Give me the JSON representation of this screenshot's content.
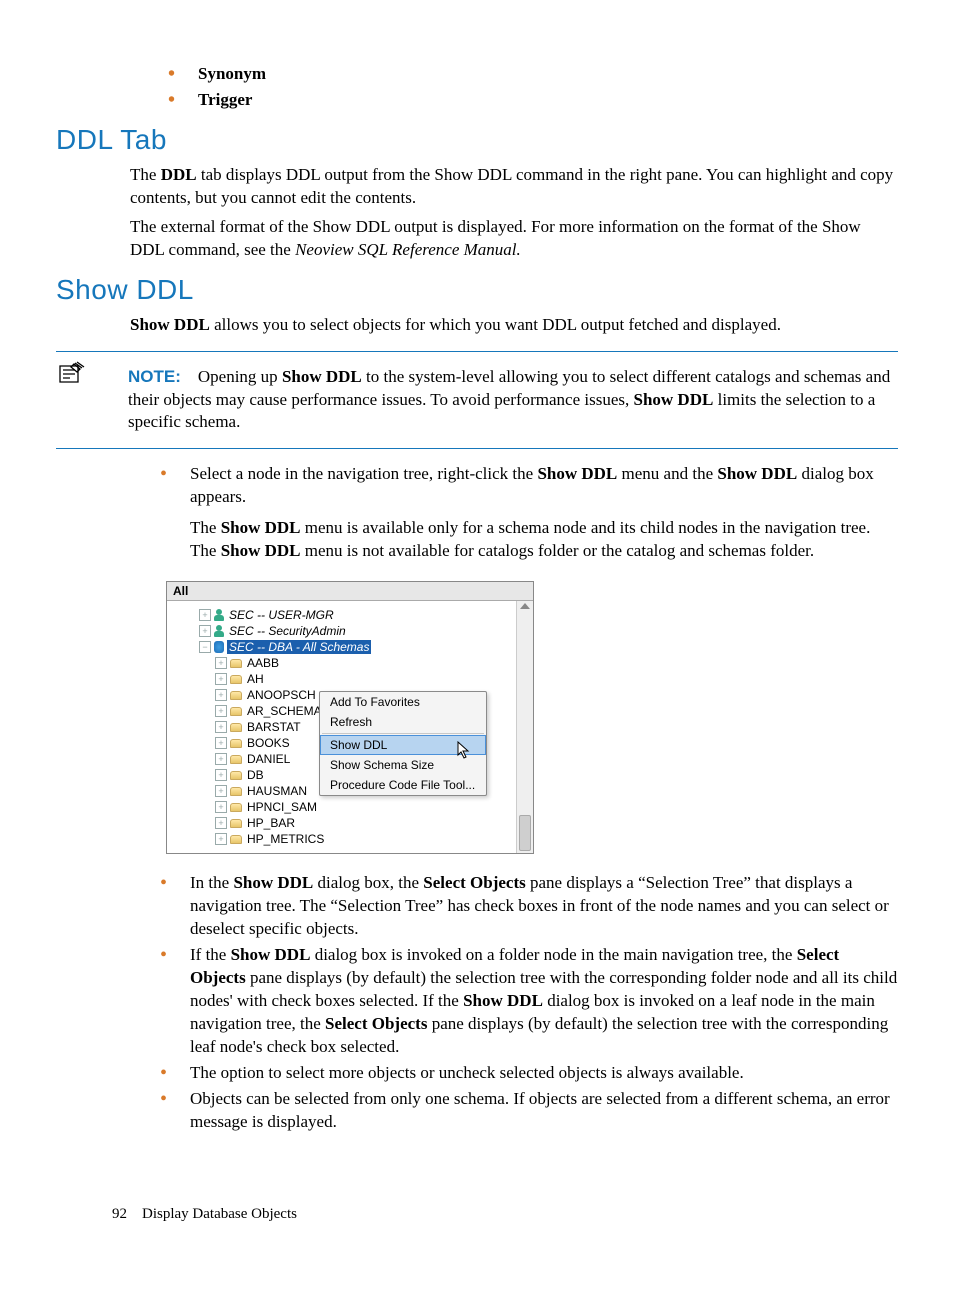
{
  "simple_list": {
    "item1": "Synonym",
    "item2": "Trigger"
  },
  "section1": {
    "title": "DDL Tab",
    "p1_a": "The ",
    "p1_b": "DDL",
    "p1_c": " tab displays DDL output from the Show DDL command in the right pane. You can highlight and copy contents, but you cannot edit the contents.",
    "p2_a": "The external format of the Show DDL output is displayed. For more information on the format of the Show DDL command, see the ",
    "p2_b": "Neoview SQL Reference Manual."
  },
  "section2": {
    "title": "Show DDL",
    "intro_a": "Show DDL",
    "intro_b": " allows you to select objects for which you want DDL output fetched and displayed.",
    "note_label": "NOTE:",
    "note_a": "Opening up ",
    "note_b": "Show DDL",
    "note_c": " to the system-level allowing you to select different catalogs and schemas and their objects may cause performance issues. To avoid performance issues, ",
    "note_d": "Show DDL",
    "note_e": " limits the selection to a specific schema.",
    "bul1_a": "Select a node in the navigation tree, right-click the ",
    "bul1_b": "Show DDL",
    "bul1_c": " menu and the ",
    "bul1_d": "Show DDL",
    "bul1_e": " dialog box appears.",
    "bul1_p_a": "The ",
    "bul1_p_b": "Show DDL",
    "bul1_p_c": " menu is available only for a schema node and its child nodes in the navigation tree. The ",
    "bul1_p_d": "Show DDL",
    "bul1_p_e": " menu is not available for catalogs folder or the catalog and schemas folder.",
    "bul2_a": "In the ",
    "bul2_b": "Show DDL",
    "bul2_c": " dialog box, the ",
    "bul2_d": "Select Objects",
    "bul2_e": " pane displays a “Selection Tree” that displays a navigation tree. The “Selection Tree” has check boxes in front of the node names and you can select or deselect specific objects.",
    "bul3_a": "If the ",
    "bul3_b": "Show DDL",
    "bul3_c": " dialog box is invoked on a folder node in the main navigation tree, the ",
    "bul3_d": "Select Objects",
    "bul3_e": " pane displays (by default) the selection tree with the corresponding folder node and all its child nodes' with check boxes selected. If the ",
    "bul3_f": "Show DDL",
    "bul3_g": " dialog box is invoked on a leaf node in the main navigation tree, the ",
    "bul3_h": "Select Objects",
    "bul3_i": " pane displays (by default) the selection tree with the corresponding leaf node's check box selected.",
    "bul4": "The option to select more objects or uncheck selected objects is always available.",
    "bul5": "Objects can be selected from only one schema. If objects are selected from a different schema, an error message is displayed."
  },
  "screenshot": {
    "tab": "All",
    "rows": [
      {
        "indent": 28,
        "exp": "+",
        "icon": "man",
        "label": "SEC -- USER-MGR",
        "ital": true
      },
      {
        "indent": 28,
        "exp": "+",
        "icon": "man",
        "label": "SEC -- SecurityAdmin",
        "ital": true
      },
      {
        "indent": 28,
        "exp": "−",
        "icon": "db",
        "label": "SEC -- DBA - All Schemas",
        "ital": true,
        "sel": true
      },
      {
        "indent": 44,
        "exp": "+",
        "icon": "drum",
        "label": "AABB"
      },
      {
        "indent": 44,
        "exp": "+",
        "icon": "drum",
        "label": "AH"
      },
      {
        "indent": 44,
        "exp": "+",
        "icon": "drum",
        "label": "ANOOPSCH"
      },
      {
        "indent": 44,
        "exp": "+",
        "icon": "drum",
        "label": "AR_SCHEMA"
      },
      {
        "indent": 44,
        "exp": "+",
        "icon": "drum",
        "label": "BARSTAT"
      },
      {
        "indent": 44,
        "exp": "+",
        "icon": "drum",
        "label": "BOOKS"
      },
      {
        "indent": 44,
        "exp": "+",
        "icon": "drum",
        "label": "DANIEL"
      },
      {
        "indent": 44,
        "exp": "+",
        "icon": "drum",
        "label": "DB"
      },
      {
        "indent": 44,
        "exp": "+",
        "icon": "drum",
        "label": "HAUSMAN"
      },
      {
        "indent": 44,
        "exp": "+",
        "icon": "drum",
        "label": "HPNCI_SAM"
      },
      {
        "indent": 44,
        "exp": "+",
        "icon": "drum",
        "label": "HP_BAR"
      },
      {
        "indent": 44,
        "exp": "+",
        "icon": "drum",
        "label": "HP_METRICS"
      }
    ],
    "ctx": {
      "i1": "Add To Favorites",
      "i2": "Refresh",
      "i3": "Show DDL",
      "i4": "Show Schema Size",
      "i5": "Procedure Code File Tool..."
    }
  },
  "footer": {
    "page": "92",
    "title": "Display Database Objects"
  }
}
